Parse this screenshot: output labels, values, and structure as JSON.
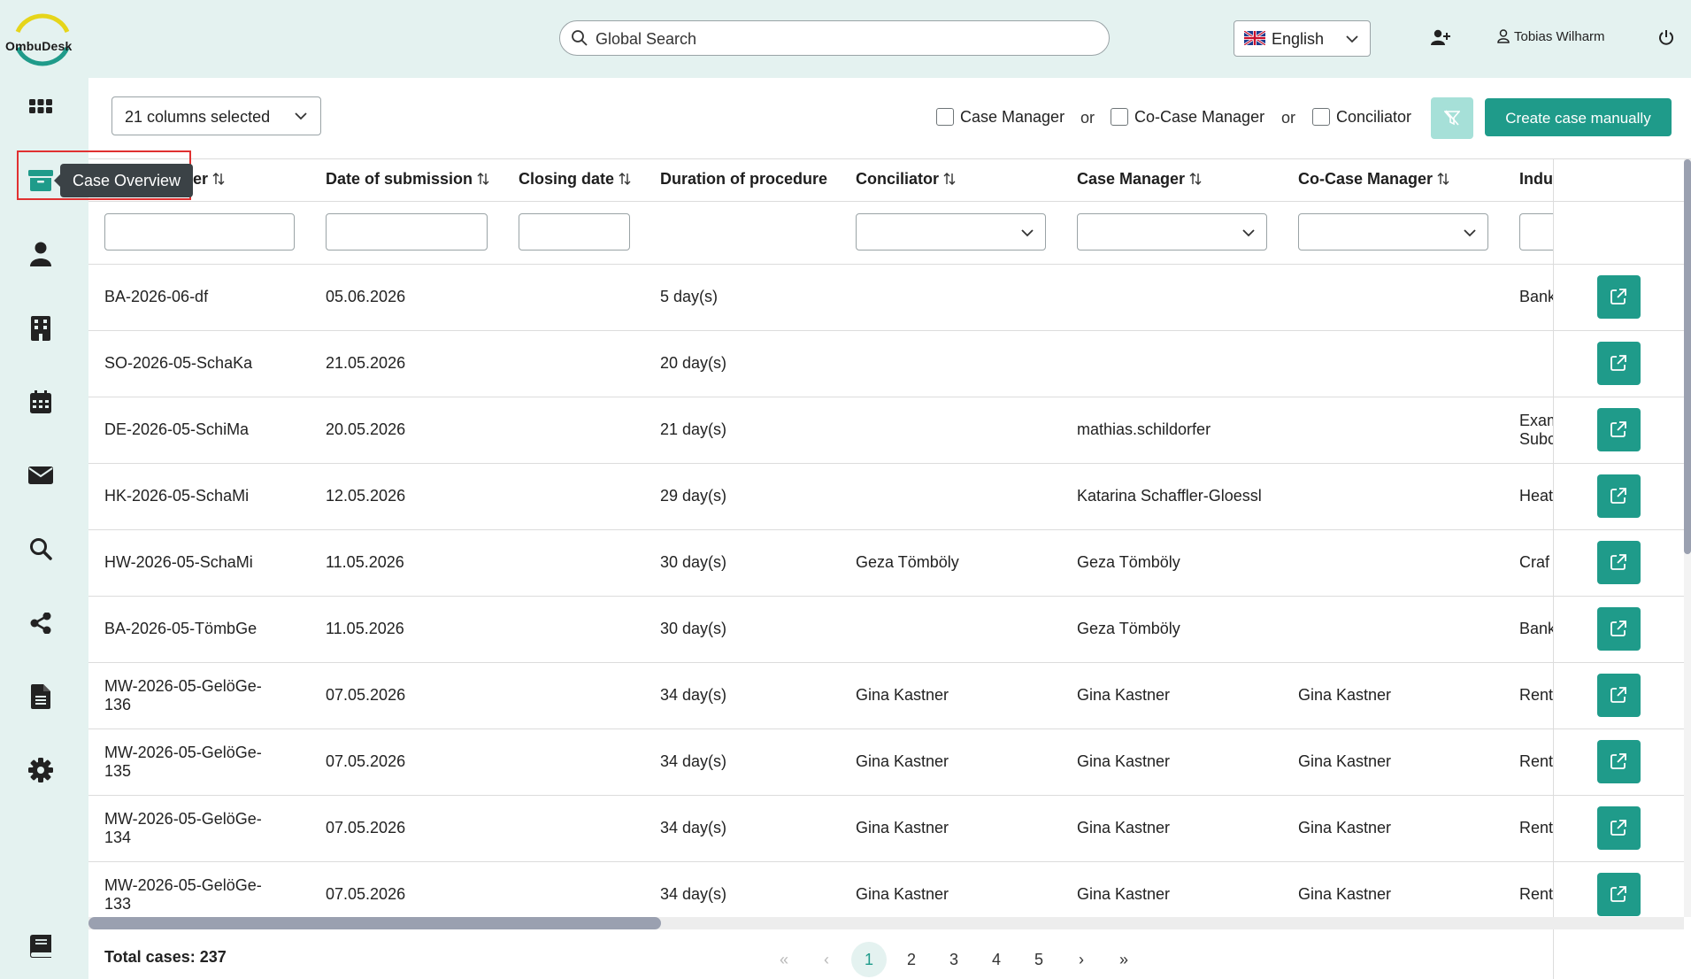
{
  "app": {
    "logo_text": "OmbuDesk"
  },
  "header": {
    "search_placeholder": "Global Search",
    "language": "English",
    "user_name": "Tobias Wilharm"
  },
  "sidebar": {
    "tooltip": "Case Overview",
    "items": [
      "apps-icon",
      "case-overview-icon",
      "person-icon",
      "building-icon",
      "calendar-icon",
      "envelope-icon",
      "search-icon",
      "share-icon",
      "document-icon",
      "gear-icon",
      "book-icon"
    ]
  },
  "toolbar": {
    "columns_selected": "21 columns selected",
    "filter_case_manager": "Case Manager",
    "filter_co_case_manager": "Co-Case Manager",
    "filter_conciliator": "Conciliator",
    "or1": "or",
    "or2": "or",
    "create_button": "Create case manually"
  },
  "table": {
    "headers": {
      "case_number": "er",
      "date_of_submission": "Date of submission",
      "closing_date": "Closing date",
      "duration": "Duration of procedure",
      "conciliator": "Conciliator",
      "case_manager": "Case Manager",
      "co_case_manager": "Co-Case Manager",
      "industry": "Indu"
    },
    "rows": [
      {
        "case": "BA-2026-06-df",
        "date": "05.06.2026",
        "closing": "",
        "duration": "5 day(s)",
        "conciliator": "",
        "case_manager": "",
        "co_case_manager": "",
        "industry": "Bank"
      },
      {
        "case": "SO-2026-05-SchaKa",
        "date": "21.05.2026",
        "closing": "",
        "duration": "20 day(s)",
        "conciliator": "",
        "case_manager": "",
        "co_case_manager": "",
        "industry": ""
      },
      {
        "case": "DE-2026-05-SchiMa",
        "date": "20.05.2026",
        "closing": "",
        "duration": "21 day(s)",
        "conciliator": "",
        "case_manager": "mathias.schildorfer",
        "co_case_manager": "",
        "industry": "Exam\nSubc"
      },
      {
        "case": "HK-2026-05-SchaMi",
        "date": "12.05.2026",
        "closing": "",
        "duration": "29 day(s)",
        "conciliator": "",
        "case_manager": "Katarina Schaffler-Gloessl",
        "co_case_manager": "",
        "industry": "Heat"
      },
      {
        "case": "HW-2026-05-SchaMi",
        "date": "11.05.2026",
        "closing": "",
        "duration": "30 day(s)",
        "conciliator": "Geza Tömböly",
        "case_manager": "Geza Tömböly",
        "co_case_manager": "",
        "industry": "Craf"
      },
      {
        "case": "BA-2026-05-TömbGe",
        "date": "11.05.2026",
        "closing": "",
        "duration": "30 day(s)",
        "conciliator": "",
        "case_manager": "Geza Tömböly",
        "co_case_manager": "",
        "industry": "Bank"
      },
      {
        "case": "MW-2026-05-GelöGe-\n136",
        "date": "07.05.2026",
        "closing": "",
        "duration": "34 day(s)",
        "conciliator": "Gina Kastner",
        "case_manager": "Gina Kastner",
        "co_case_manager": "Gina Kastner",
        "industry": "Rent"
      },
      {
        "case": "MW-2026-05-GelöGe-\n135",
        "date": "07.05.2026",
        "closing": "",
        "duration": "34 day(s)",
        "conciliator": "Gina Kastner",
        "case_manager": "Gina Kastner",
        "co_case_manager": "Gina Kastner",
        "industry": "Rent"
      },
      {
        "case": "MW-2026-05-GelöGe-\n134",
        "date": "07.05.2026",
        "closing": "",
        "duration": "34 day(s)",
        "conciliator": "Gina Kastner",
        "case_manager": "Gina Kastner",
        "co_case_manager": "Gina Kastner",
        "industry": "Rent"
      },
      {
        "case": "MW-2026-05-GelöGe-\n133",
        "date": "07.05.2026",
        "closing": "",
        "duration": "34 day(s)",
        "conciliator": "Gina Kastner",
        "case_manager": "Gina Kastner",
        "co_case_manager": "Gina Kastner",
        "industry": "Rent"
      }
    ]
  },
  "footer": {
    "total": "Total cases: 237",
    "pages": [
      "1",
      "2",
      "3",
      "4",
      "5"
    ],
    "current_page": "1",
    "first": "«",
    "prev": "‹",
    "next": "›",
    "last": "»"
  },
  "colors": {
    "accent": "#1f9b8a",
    "sidebar_bg": "#e4f2f0",
    "filter_button": "#a6e0d8",
    "highlight": "#e03131"
  }
}
